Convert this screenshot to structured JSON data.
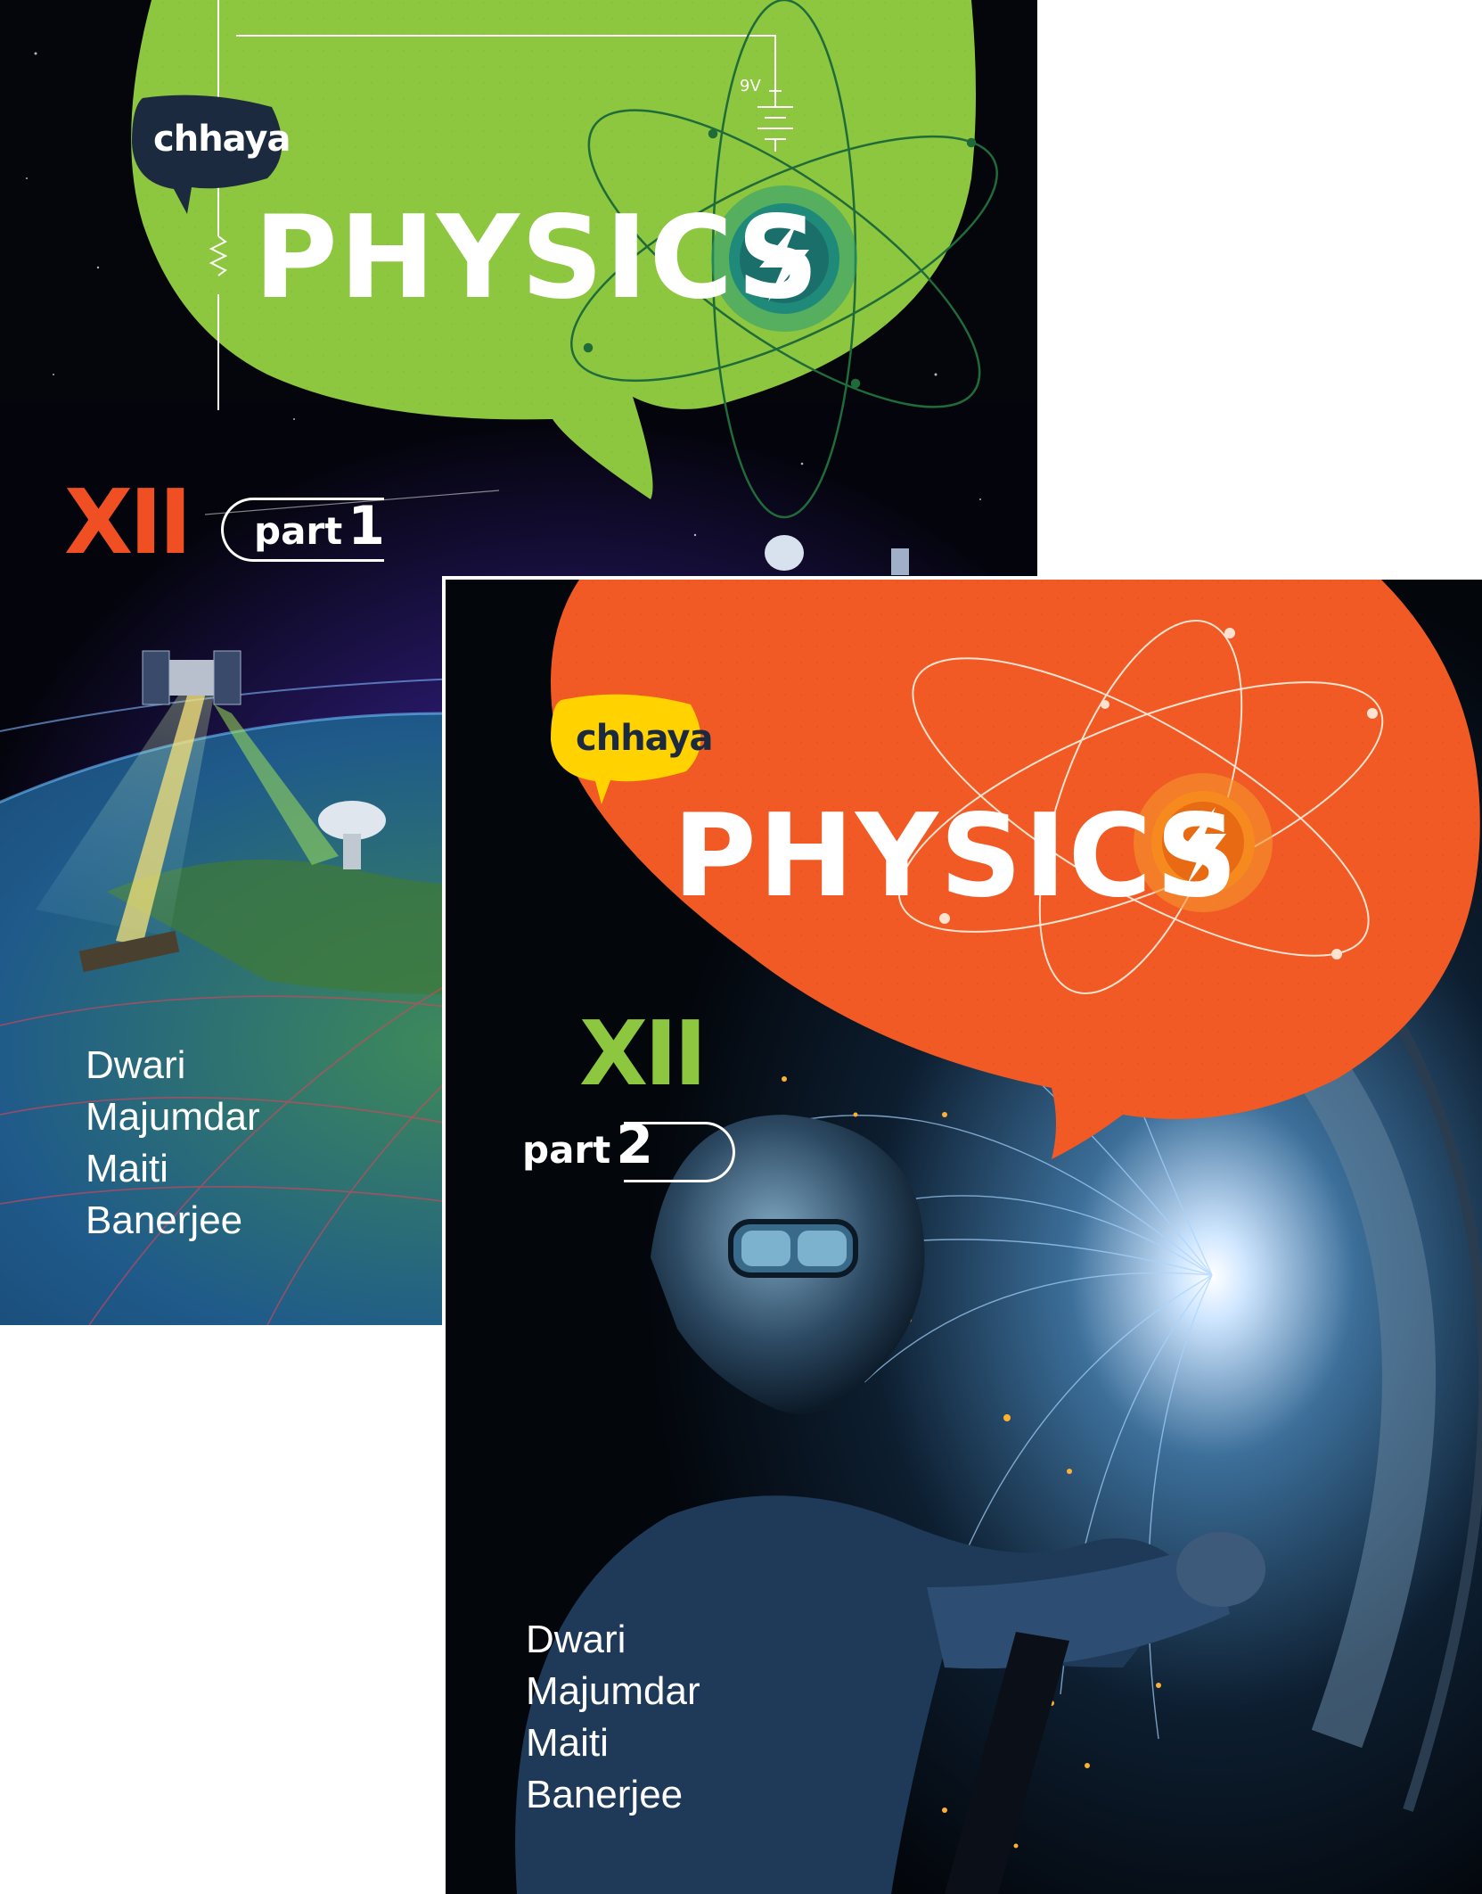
{
  "brand": "chhaya",
  "subject": "PHYSICS",
  "books": [
    {
      "grade": "XII",
      "part_word": "part",
      "part_number": "1",
      "authors": [
        "Dwari",
        "Majumdar",
        "Maiti",
        "Banerjee"
      ],
      "bubble_color": "#8dc63f",
      "grade_color": "#f04e23"
    },
    {
      "grade": "XII",
      "part_word": "part",
      "part_number": "2",
      "authors": [
        "Dwari",
        "Majumdar",
        "Maiti",
        "Banerjee"
      ],
      "bubble_color": "#f15a24",
      "grade_color": "#8dc63f"
    }
  ],
  "icons": [
    "lightning-bolt-icon",
    "atom-orbit-icon",
    "battery-9v-symbol",
    "resistor-symbol"
  ],
  "circuit_label": "9V"
}
